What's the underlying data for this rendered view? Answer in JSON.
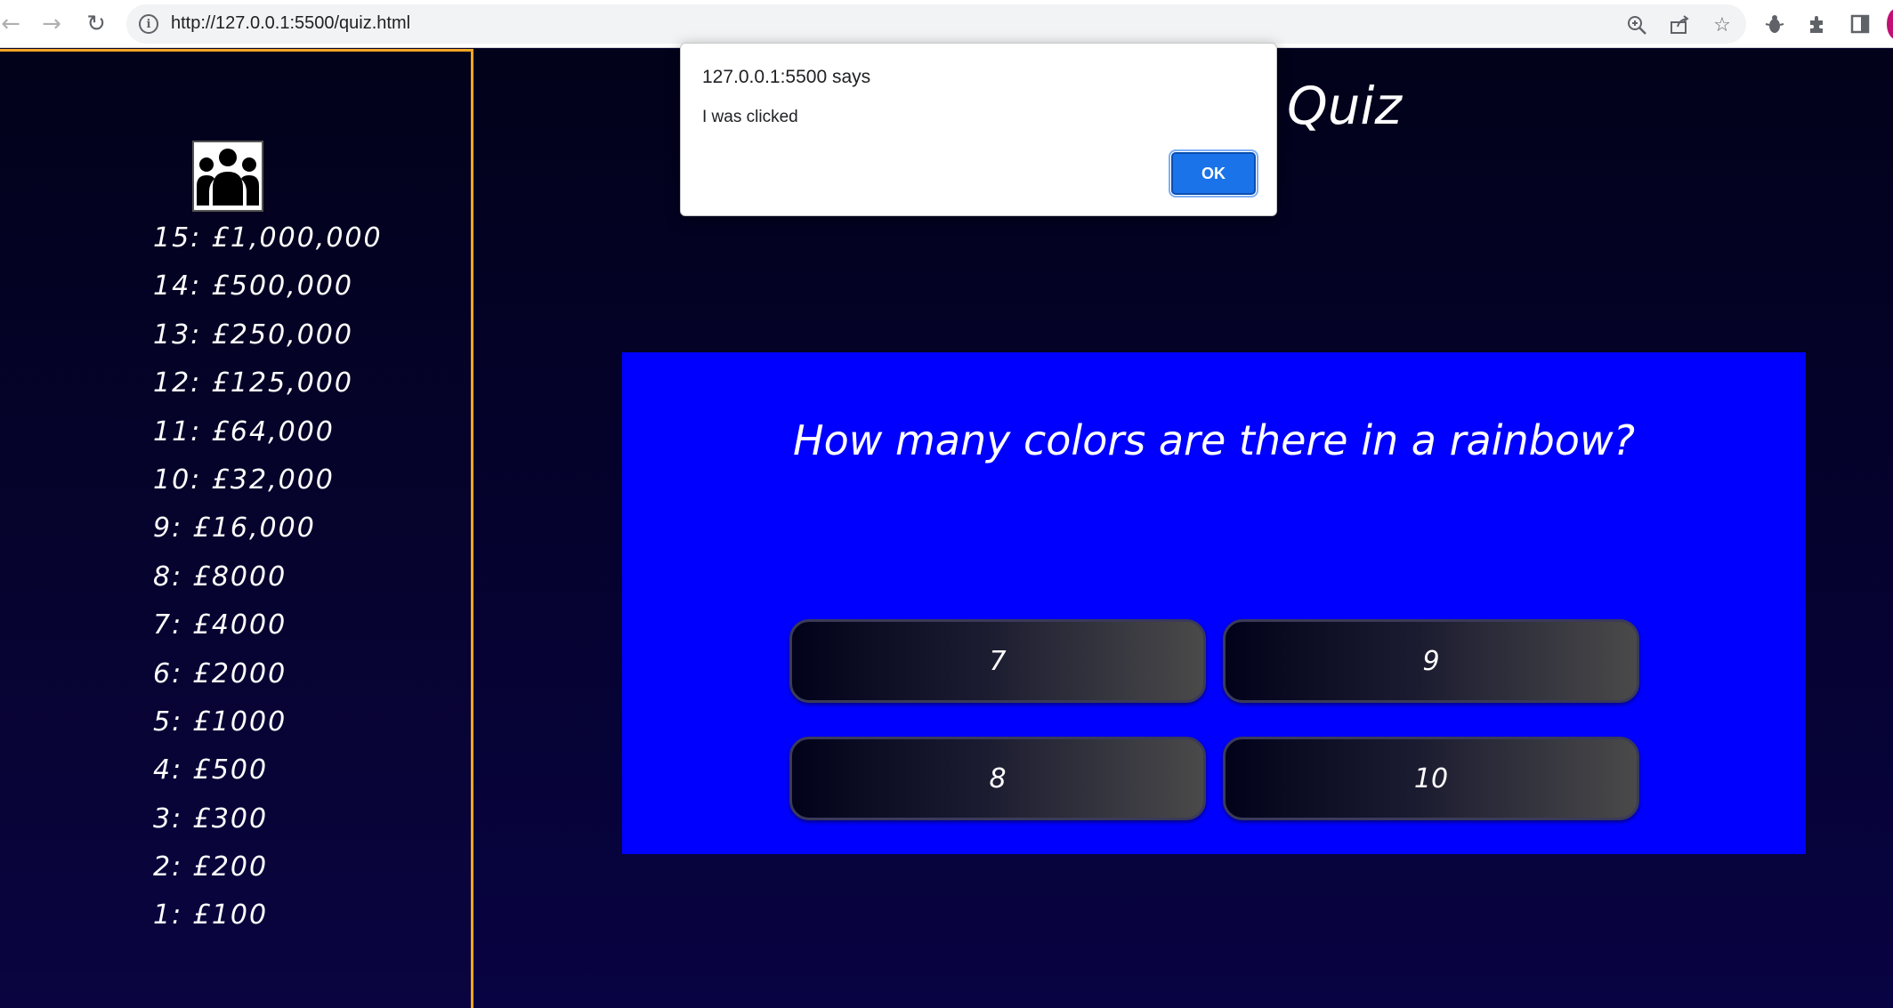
{
  "browser": {
    "url": "http://127.0.0.1:5500/quiz.html",
    "icons": {
      "back": "arrow-left-icon",
      "forward": "arrow-right-icon",
      "reload": "reload-icon",
      "site_info": "info-icon",
      "zoom": "zoom-icon",
      "share": "share-icon",
      "bookmark": "star-icon",
      "extension": "bug-icon",
      "extensions": "puzzle-icon",
      "side_panel": "side-panel-icon"
    }
  },
  "sidebar": {
    "lifeline_icon": "ask-the-audience-icon",
    "prizes": [
      "15: £1,000,000",
      "14: £500,000",
      "13: £250,000",
      "12: £125,000",
      "11: £64,000",
      "10: £32,000",
      "9: £16,000",
      "8: £8000",
      "7: £4000",
      "6: £2000",
      "5: £1000",
      "4: £500",
      "3: £300",
      "2: £200",
      "1: £100"
    ]
  },
  "main": {
    "title_visible": "Quiz",
    "question": "How many colors are there in a rainbow?",
    "answers": [
      "7",
      "9",
      "8",
      "10"
    ]
  },
  "dialog": {
    "title": "127.0.0.1:5500 says",
    "message": "I was clicked",
    "ok_label": "OK"
  },
  "colors": {
    "accent_border": "#f5a623",
    "question_panel": "#0000ff",
    "ok_button": "#1a73e8"
  }
}
